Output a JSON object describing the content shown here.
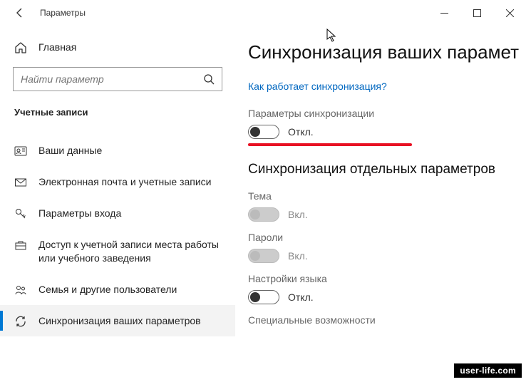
{
  "titlebar": {
    "title": "Параметры"
  },
  "sidebar": {
    "home": "Главная",
    "search_placeholder": "Найти параметр",
    "section": "Учетные записи",
    "items": [
      {
        "label": "Ваши данные"
      },
      {
        "label": "Электронная почта и учетные записи"
      },
      {
        "label": "Параметры входа"
      },
      {
        "label": "Доступ к учетной записи места работы или учебного заведения"
      },
      {
        "label": "Семья и другие пользователи"
      },
      {
        "label": "Синхронизация ваших параметров"
      }
    ]
  },
  "main": {
    "title": "Синхронизация ваших парамет",
    "link": "Как работает синхронизация?",
    "sync_label": "Параметры синхронизации",
    "sync_state": "Откл.",
    "section": "Синхронизация отдельных параметров",
    "settings": [
      {
        "label": "Тема",
        "state": "Вкл."
      },
      {
        "label": "Пароли",
        "state": "Вкл."
      },
      {
        "label": "Настройки языка",
        "state": "Откл."
      },
      {
        "label": "Специальные возможности",
        "state": ""
      }
    ]
  },
  "watermark": "user-life.com"
}
